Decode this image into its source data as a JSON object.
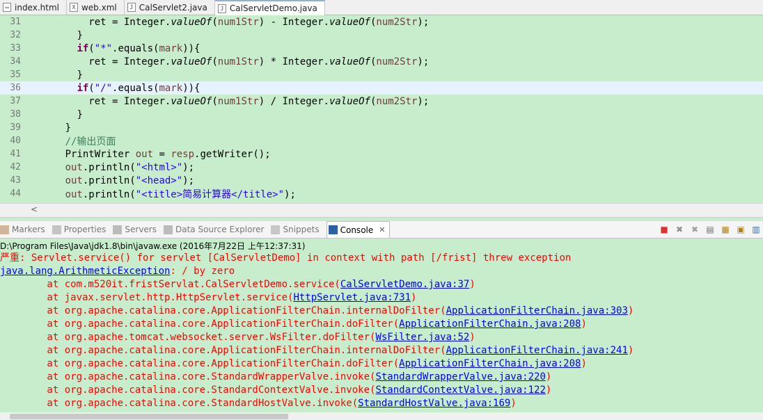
{
  "tabs": [
    {
      "label": "index.html",
      "icon": "html-file-icon",
      "glyph": "▭",
      "active": false
    },
    {
      "label": "web.xml",
      "icon": "xml-file-icon",
      "glyph": "X",
      "active": false
    },
    {
      "label": "CalServlet2.java",
      "icon": "java-file-icon",
      "glyph": "J",
      "active": false
    },
    {
      "label": "CalServletDemo.java",
      "icon": "java-file-icon",
      "glyph": "J",
      "active": true
    }
  ],
  "code_lines": [
    {
      "num": "31",
      "indent": 10,
      "tokens": [
        [
          "",
          "ret = Integer."
        ],
        [
          "it",
          "valueOf"
        ],
        [
          "",
          "("
        ],
        [
          "var",
          "num1Str"
        ],
        [
          "",
          ") - Integer."
        ],
        [
          "it",
          "valueOf"
        ],
        [
          "",
          "("
        ],
        [
          "var",
          "num2Str"
        ],
        [
          "",
          ");"
        ]
      ]
    },
    {
      "num": "32",
      "indent": 8,
      "tokens": [
        [
          "",
          "}"
        ]
      ]
    },
    {
      "num": "33",
      "indent": 8,
      "tokens": [
        [
          "kw",
          "if"
        ],
        [
          "",
          "("
        ],
        [
          "str",
          "\"*\""
        ],
        [
          "",
          ".equals("
        ],
        [
          "var",
          "mark"
        ],
        [
          "",
          ")){"
        ]
      ]
    },
    {
      "num": "34",
      "indent": 10,
      "tokens": [
        [
          "",
          "ret = Integer."
        ],
        [
          "it",
          "valueOf"
        ],
        [
          "",
          "("
        ],
        [
          "var",
          "num1Str"
        ],
        [
          "",
          ") * Integer."
        ],
        [
          "it",
          "valueOf"
        ],
        [
          "",
          "("
        ],
        [
          "var",
          "num2Str"
        ],
        [
          "",
          ");"
        ]
      ]
    },
    {
      "num": "35",
      "indent": 8,
      "tokens": [
        [
          "",
          "}"
        ]
      ]
    },
    {
      "num": "36",
      "indent": 8,
      "current": true,
      "tokens": [
        [
          "kw",
          "if"
        ],
        [
          "",
          "("
        ],
        [
          "str",
          "\"/\""
        ],
        [
          "",
          ".equals("
        ],
        [
          "var",
          "mark"
        ],
        [
          "",
          ")){"
        ]
      ]
    },
    {
      "num": "37",
      "indent": 10,
      "tokens": [
        [
          "",
          "ret = Integer."
        ],
        [
          "it",
          "valueOf"
        ],
        [
          "",
          "("
        ],
        [
          "var",
          "num1Str"
        ],
        [
          "",
          ") / Integer."
        ],
        [
          "it",
          "valueOf"
        ],
        [
          "",
          "("
        ],
        [
          "var",
          "num2Str"
        ],
        [
          "",
          ");"
        ]
      ]
    },
    {
      "num": "38",
      "indent": 8,
      "tokens": [
        [
          "",
          "}"
        ]
      ]
    },
    {
      "num": "39",
      "indent": 6,
      "tokens": [
        [
          "",
          "}"
        ]
      ]
    },
    {
      "num": "40",
      "indent": 6,
      "tokens": [
        [
          "cmt",
          "//输出页面"
        ]
      ]
    },
    {
      "num": "41",
      "indent": 6,
      "tokens": [
        [
          "",
          "PrintWriter "
        ],
        [
          "var",
          "out"
        ],
        [
          "",
          " = "
        ],
        [
          "var",
          "resp"
        ],
        [
          "",
          ".getWriter();"
        ]
      ]
    },
    {
      "num": "42",
      "indent": 6,
      "tokens": [
        [
          "var",
          "out"
        ],
        [
          "",
          ".println("
        ],
        [
          "str",
          "\"<html>\""
        ],
        [
          "",
          ");"
        ]
      ]
    },
    {
      "num": "43",
      "indent": 6,
      "tokens": [
        [
          "var",
          "out"
        ],
        [
          "",
          ".println("
        ],
        [
          "str",
          "\"<head>\""
        ],
        [
          "",
          ");"
        ]
      ]
    },
    {
      "num": "44",
      "indent": 6,
      "tokens": [
        [
          "var",
          "out"
        ],
        [
          "",
          ".println("
        ],
        [
          "str",
          "\"<title>简易计算器</title>\""
        ],
        [
          "",
          ");"
        ]
      ]
    }
  ],
  "view_tabs": [
    {
      "label": "Markers",
      "icon": "markers-icon",
      "color": "#b08050",
      "active": false
    },
    {
      "label": "Properties",
      "icon": "properties-icon",
      "color": "#9a9a9a",
      "active": false
    },
    {
      "label": "Servers",
      "icon": "servers-icon",
      "color": "#8a8a8a",
      "active": false
    },
    {
      "label": "Data Source Explorer",
      "icon": "data-source-icon",
      "color": "#8a8a8a",
      "active": false
    },
    {
      "label": "Snippets",
      "icon": "snippets-icon",
      "color": "#a0a0a0",
      "active": false
    },
    {
      "label": "Console",
      "icon": "console-icon",
      "color": "#2d5fa5",
      "active": true
    }
  ],
  "console": {
    "close_glyph": "✕",
    "launch_line": "D:\\Program Files\\Java\\jdk1.8\\bin\\javaw.exe (2016年7月22日 上午12:37:31)",
    "lines": [
      [
        [
          "",
          "严重: Servlet.service() for servlet [CalServletDemo] in context with path [/frist] threw exception"
        ]
      ],
      [
        [
          "lnk",
          "java.lang.ArithmeticException"
        ],
        [
          "",
          ": / by zero"
        ]
      ],
      [
        [
          "",
          "\tat com.m520it.fristServlat.CalServletDemo.service("
        ],
        [
          "lnk",
          "CalServletDemo.java:37"
        ],
        [
          "",
          ")"
        ]
      ],
      [
        [
          "",
          "\tat javax.servlet.http.HttpServlet.service("
        ],
        [
          "lnk",
          "HttpServlet.java:731"
        ],
        [
          "",
          ")"
        ]
      ],
      [
        [
          "",
          "\tat org.apache.catalina.core.ApplicationFilterChain.internalDoFilter("
        ],
        [
          "lnk",
          "ApplicationFilterChain.java:303"
        ],
        [
          "",
          ")"
        ]
      ],
      [
        [
          "",
          "\tat org.apache.catalina.core.ApplicationFilterChain.doFilter("
        ],
        [
          "lnk",
          "ApplicationFilterChain.java:208"
        ],
        [
          "",
          ")"
        ]
      ],
      [
        [
          "",
          "\tat org.apache.tomcat.websocket.server.WsFilter.doFilter("
        ],
        [
          "lnk",
          "WsFilter.java:52"
        ],
        [
          "",
          ")"
        ]
      ],
      [
        [
          "",
          "\tat org.apache.catalina.core.ApplicationFilterChain.internalDoFilter("
        ],
        [
          "lnk",
          "ApplicationFilterChain.java:241"
        ],
        [
          "",
          ")"
        ]
      ],
      [
        [
          "",
          "\tat org.apache.catalina.core.ApplicationFilterChain.doFilter("
        ],
        [
          "lnk",
          "ApplicationFilterChain.java:208"
        ],
        [
          "",
          ")"
        ]
      ],
      [
        [
          "",
          "\tat org.apache.catalina.core.StandardWrapperValve.invoke("
        ],
        [
          "lnk",
          "StandardWrapperValve.java:220"
        ],
        [
          "",
          ")"
        ]
      ],
      [
        [
          "",
          "\tat org.apache.catalina.core.StandardContextValve.invoke("
        ],
        [
          "lnk",
          "StandardContextValve.java:122"
        ],
        [
          "",
          ")"
        ]
      ],
      [
        [
          "",
          "\tat org.apache.catalina.core.StandardHostValve.invoke("
        ],
        [
          "lnk",
          "StandardHostValve.java:169"
        ],
        [
          "",
          ")"
        ]
      ]
    ]
  },
  "toolbar": [
    {
      "name": "terminate-icon",
      "glyph": "■",
      "color": "#e03030"
    },
    {
      "name": "remove-launch-icon",
      "glyph": "✖",
      "color": "#909090"
    },
    {
      "name": "remove-all-terminated-icon",
      "glyph": "✖",
      "color": "#a0a0a0"
    },
    {
      "name": "clear-console-icon",
      "glyph": "▤",
      "color": "#6a6a6a"
    },
    {
      "name": "scroll-lock-icon",
      "glyph": "▦",
      "color": "#b08020"
    },
    {
      "name": "pin-console-icon",
      "glyph": "▣",
      "color": "#b08020"
    },
    {
      "name": "display-selected-console-icon",
      "glyph": "▥",
      "color": "#3a6aa8"
    }
  ],
  "scroll_left_glyph": "<"
}
